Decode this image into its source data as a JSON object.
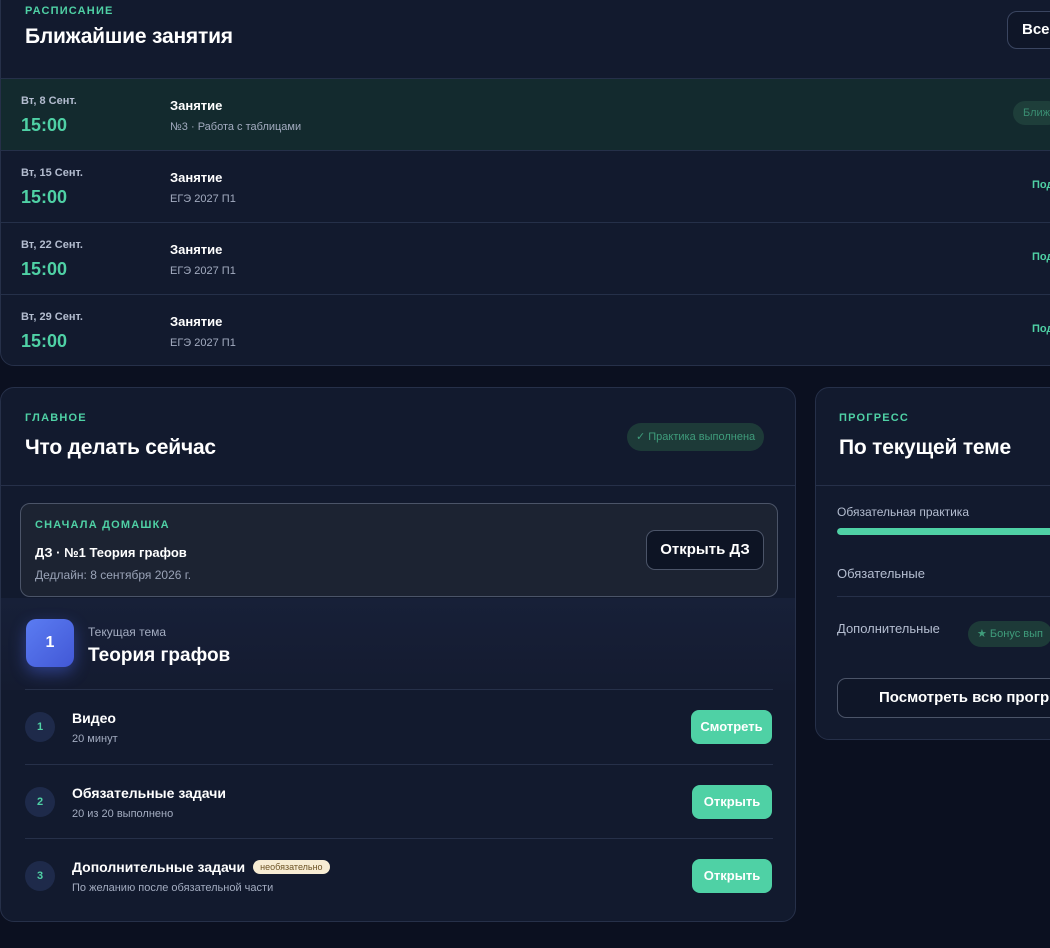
{
  "schedule": {
    "eyebrow": "РАСПИСАНИЕ",
    "title": "Ближайшие занятия",
    "all_button": "Все",
    "rows": [
      {
        "date": "Вт, 8 Сент.",
        "time": "15:00",
        "name": "Занятие",
        "sub": "№3 · Работа с таблицами",
        "status": "Ближ"
      },
      {
        "date": "Вт, 15 Сент.",
        "time": "15:00",
        "name": "Занятие",
        "sub": "ЕГЭ 2027 П1",
        "status": "Под"
      },
      {
        "date": "Вт, 22 Сент.",
        "time": "15:00",
        "name": "Занятие",
        "sub": "ЕГЭ 2027 П1",
        "status": "Под"
      },
      {
        "date": "Вт, 29 Сент.",
        "time": "15:00",
        "name": "Занятие",
        "sub": "ЕГЭ 2027 П1",
        "status": "Под"
      }
    ]
  },
  "main": {
    "eyebrow": "ГЛАВНОЕ",
    "title": "Что делать сейчас",
    "done_badge": "✓ Практика выполнена",
    "homework": {
      "eyebrow": "СНАЧАЛА ДОМАШКА",
      "title": "ДЗ · №1 Теория графов",
      "deadline": "Дедлайн: 8 сентября 2026 г.",
      "button": "Открыть ДЗ"
    },
    "topic": {
      "number": "1",
      "label": "Текущая тема",
      "name": "Теория графов"
    },
    "steps": [
      {
        "num": "1",
        "title": "Видео",
        "sub": "20 минут",
        "button": "Смотреть",
        "tag": ""
      },
      {
        "num": "2",
        "title": "Обязательные задачи",
        "sub": "20 из 20 выполнено",
        "button": "Открыть",
        "tag": ""
      },
      {
        "num": "3",
        "title": "Дополнительные задачи",
        "sub": "По желанию после обязательной части",
        "button": "Открыть",
        "tag": "необязательно"
      }
    ]
  },
  "progress": {
    "eyebrow": "ПРОГРЕСС",
    "title": "По текущей теме",
    "practice_label": "Обязательная практика",
    "practice_fraction": 1.0,
    "required_label": "Обязательные",
    "extra_label": "Дополнительные",
    "bonus_pill": "★ Бонус вып",
    "button": "Посмотреть всю прогр"
  },
  "colors": {
    "accent": "#4fd1a5",
    "background": "#0b1020",
    "card": "#121a2e",
    "topic_badge": "#4c67ea"
  }
}
